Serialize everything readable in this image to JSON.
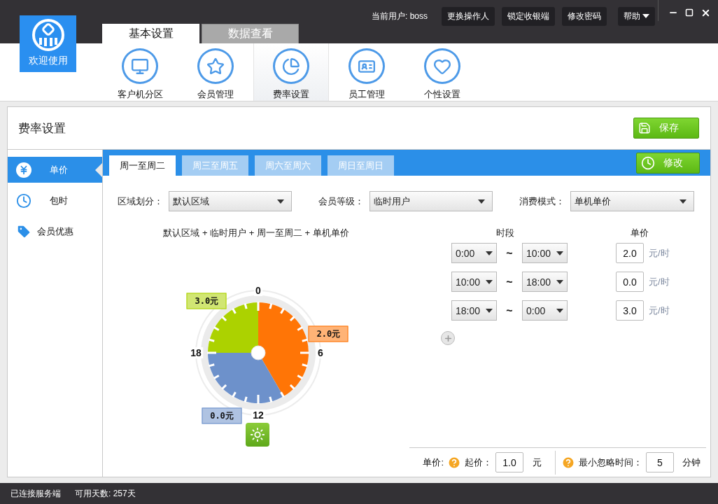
{
  "logo": {
    "label": "欢迎使用"
  },
  "user_bar": {
    "current_user": "当前用户: boss",
    "buttons": [
      "更换操作人",
      "锁定收银端",
      "修改密码"
    ],
    "help": "帮助"
  },
  "top_tabs": [
    {
      "label": "基本设置",
      "selected": true
    },
    {
      "label": "数据查看",
      "selected": false
    }
  ],
  "nav": [
    {
      "label": "客户机分区",
      "selected": false
    },
    {
      "label": "会员管理",
      "selected": false
    },
    {
      "label": "费率设置",
      "selected": true
    },
    {
      "label": "员工管理",
      "selected": false
    },
    {
      "label": "个性设置",
      "selected": false
    }
  ],
  "page": {
    "title": "费率设置",
    "save_button": "保存"
  },
  "sidebar": [
    {
      "label": "单价",
      "selected": true
    },
    {
      "label": "包时",
      "selected": false
    },
    {
      "label": "会员优惠",
      "selected": false
    }
  ],
  "day_tabs": [
    {
      "label": "周一至周二",
      "selected": true
    },
    {
      "label": "周三至周五",
      "selected": false
    },
    {
      "label": "周六至周六",
      "selected": false
    },
    {
      "label": "周日至周日",
      "selected": false
    }
  ],
  "edit_button": "修改",
  "filters": [
    {
      "label": "区域划分：",
      "value": "默认区域"
    },
    {
      "label": "会员等级：",
      "value": "临时用户"
    },
    {
      "label": "消费模式：",
      "value": "单机单价"
    }
  ],
  "summary": "默认区域 + 临时用户 + 周一至周二 + 单机单价",
  "clock": {
    "hour_labels": [
      "0",
      "6",
      "12",
      "18"
    ]
  },
  "rates": {
    "columns": [
      "时段",
      "单价"
    ],
    "rows": [
      {
        "start": "0:00",
        "separator": "~",
        "end": "10:00",
        "price": "2.0",
        "unit": "元/时",
        "bubble": "2.0元",
        "color": "#ff7506"
      },
      {
        "start": "10:00",
        "separator": "~",
        "end": "18:00",
        "price": "0.0",
        "unit": "元/时",
        "bubble": "0.0元",
        "color": "#6d91cb"
      },
      {
        "start": "18:00",
        "separator": "~",
        "end": "0:00",
        "price": "3.0",
        "unit": "元/时",
        "bubble": "3.0元",
        "color": "#acd200"
      }
    ]
  },
  "footer": {
    "label": "单价:",
    "start_label": "起价：",
    "start_value": "1.0",
    "start_unit": "元",
    "min_label": "最小忽略时间：",
    "min_value": "5",
    "min_unit": "分钟"
  },
  "status_bar": [
    "已连接服务端",
    "可用天数: 257天"
  ]
}
